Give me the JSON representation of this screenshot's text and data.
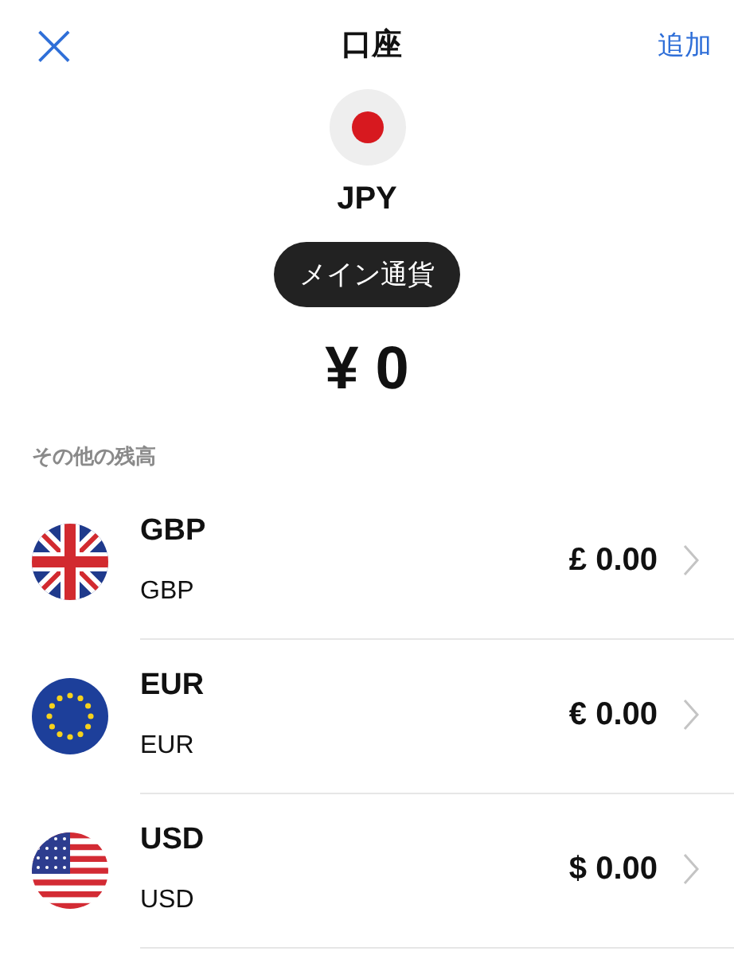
{
  "header": {
    "close": "×",
    "title": "口座",
    "action": "追加"
  },
  "main": {
    "kind": "jp",
    "code": "JPY",
    "badge": "メイン通貨",
    "balance": "¥ 0"
  },
  "section_label": "その他の残高",
  "accounts": [
    {
      "kind": "uk",
      "code": "GBP",
      "name": "GBP",
      "amount": "£ 0.00"
    },
    {
      "kind": "eu",
      "code": "EUR",
      "name": "EUR",
      "amount": "€ 0.00"
    },
    {
      "kind": "us",
      "code": "USD",
      "name": "USD",
      "amount": "$ 0.00"
    }
  ]
}
